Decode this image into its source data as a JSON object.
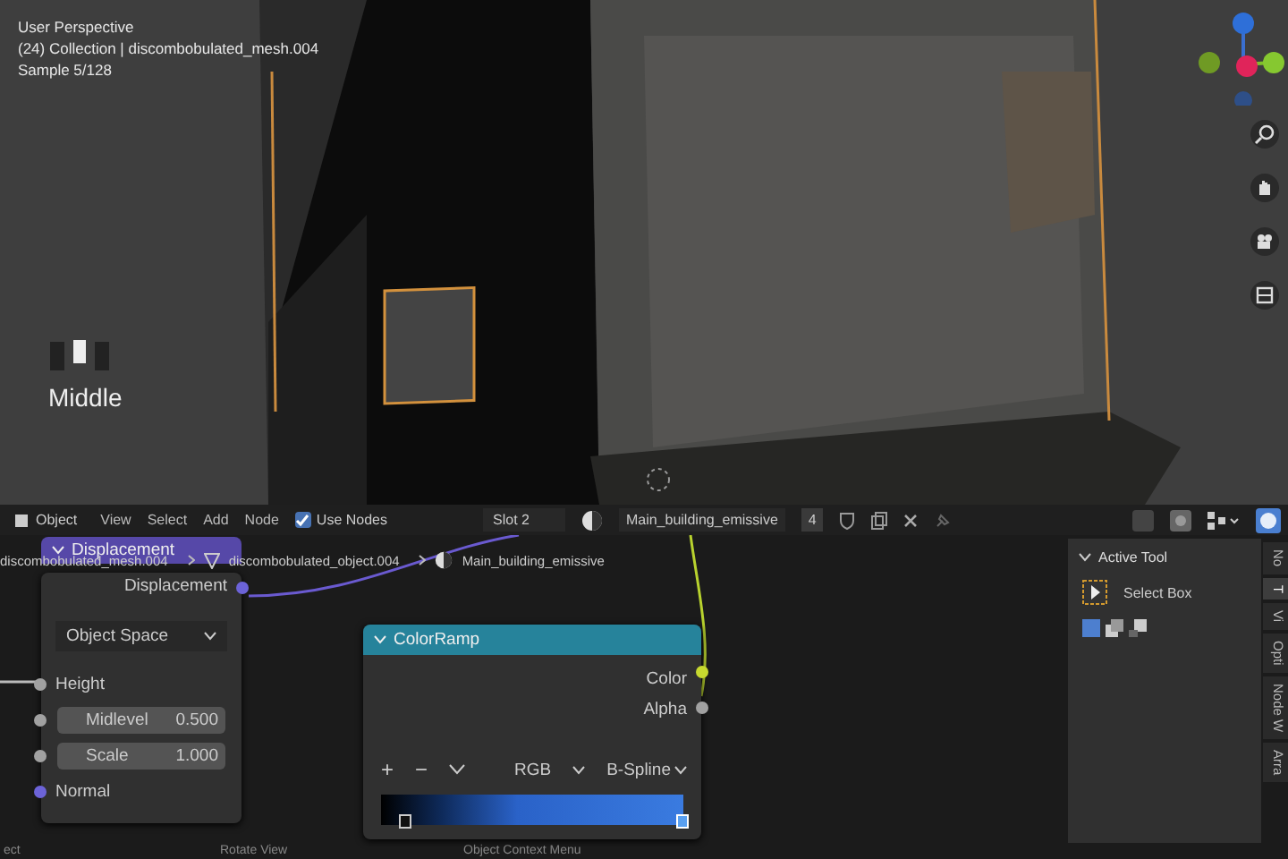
{
  "viewport": {
    "overlay_lines": [
      "User Perspective",
      "(24) Collection | discombobulated_mesh.004",
      "Sample 5/128"
    ],
    "mouse_label": "Middle"
  },
  "node_editor": {
    "header": {
      "mode": "Object",
      "menus": [
        "View",
        "Select",
        "Add",
        "Node"
      ],
      "use_nodes": {
        "label": "Use Nodes",
        "checked": true
      },
      "slot": "Slot 2",
      "material": "Main_building_emissive",
      "users": "4"
    },
    "breadcrumbs": [
      "discombobulated_mesh.004",
      "discombobulated_object.004",
      "Main_building_emissive"
    ],
    "displacement_node": {
      "title": "Displacement",
      "output": "Displacement",
      "space": "Object Space",
      "inputs": [
        {
          "kind": "socket",
          "label": "Height"
        },
        {
          "kind": "field",
          "label": "Midlevel",
          "value": "0.500"
        },
        {
          "kind": "field",
          "label": "Scale",
          "value": "1.000"
        },
        {
          "kind": "socket",
          "label": "Normal"
        }
      ]
    },
    "colorramp_node": {
      "title": "ColorRamp",
      "outputs": [
        "Color",
        "Alpha"
      ],
      "tools": [
        "+",
        "−"
      ],
      "color_mode": "RGB",
      "interpolation": "B-Spline",
      "stops": [
        {
          "level": 0.08,
          "selected": false
        },
        {
          "level": 1,
          "selected": true
        }
      ]
    },
    "sidebar": {
      "panel_title": "Active Tool",
      "tool": "Select Box",
      "tabs": [
        {
          "label": "No",
          "selected": false
        },
        {
          "label": "T",
          "selected": true
        },
        {
          "label": "Vi",
          "selected": false
        },
        {
          "label": "Opti",
          "selected": false
        },
        {
          "label": "Node W",
          "selected": false
        },
        {
          "label": "Arra",
          "selected": false
        }
      ]
    }
  },
  "status_bar": [
    "ect",
    "Rotate View",
    "Object Context Menu"
  ]
}
